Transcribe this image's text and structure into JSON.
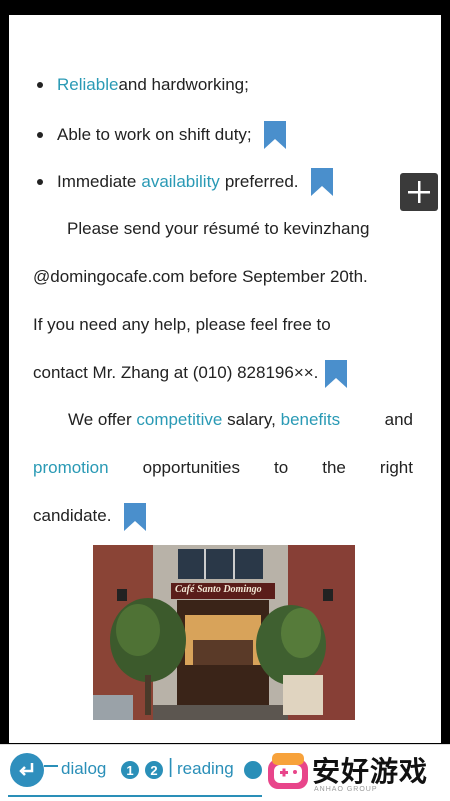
{
  "bullets": [
    {
      "highlight": "Reliable",
      "rest": " and hardworking;"
    },
    {
      "text": "Able to work on shift duty;"
    },
    {
      "pre": "Immediate ",
      "highlight": "availability",
      "post": " preferred."
    }
  ],
  "paragraph1": {
    "line1": "Please send your résumé to kevinzhang",
    "line2": "@domingocafe.com before September 20th.",
    "line3": "If you need any help, please feel free to",
    "line4": "contact Mr. Zhang at (010) 828196××."
  },
  "paragraph2": {
    "l1_pre": "We offer ",
    "l1_kw1": "competitive",
    "l1_mid": " salary, ",
    "l1_kw2": "benefits",
    "l1_post": " and",
    "l2_kw": "promotion",
    "l2_w1": "opportunities",
    "l2_w2": "to",
    "l2_w3": "the",
    "l2_w4": "right",
    "l3": "candidate."
  },
  "photo": {
    "sign_text": "Café Santo Domingo"
  },
  "bottom": {
    "nav_dialog": "dialog",
    "num1": "1",
    "num2": "2",
    "nav_reading": "reading",
    "separator": "|"
  },
  "watermark": {
    "text": "安好游戏",
    "sub": "ANHAO GROUP"
  },
  "colors": {
    "keyword": "#2a9ab5",
    "bookmark": "#4a8fcc",
    "nav": "#2a8fb8"
  }
}
